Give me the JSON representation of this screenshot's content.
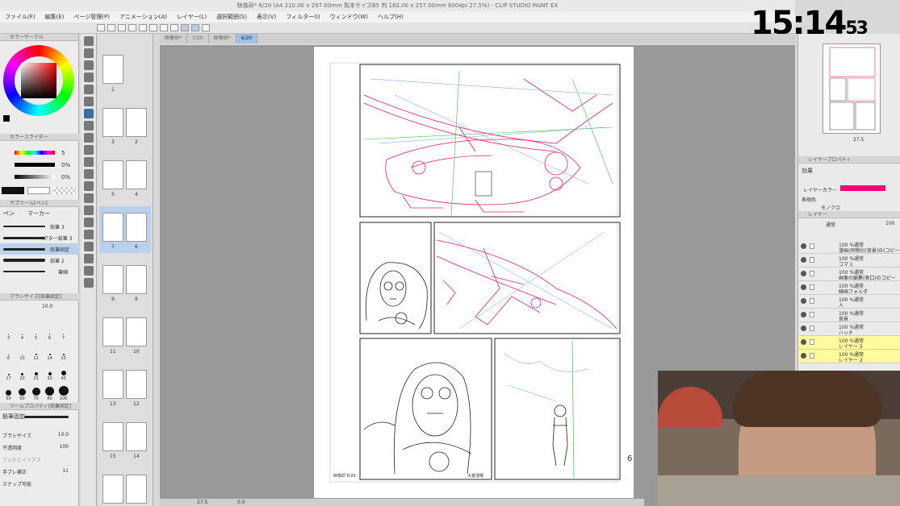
{
  "window": {
    "title": "映像研* 6/20 (A4 210.00 x 297.00mm 製本サイズB5 判 182.00 x 257.00mm 600dpi 27.5%) - CLIP STUDIO PAINT EX"
  },
  "menu": [
    "ファイル(F)",
    "編集(E)",
    "ページ管理(P)",
    "アニメーション(A)",
    "レイヤー(L)",
    "選択範囲(S)",
    "表示(V)",
    "フィルター(I)",
    "ウィンドウ(W)",
    "ヘルプ(H)"
  ],
  "clock": {
    "hm": "15:14",
    "sec": "53"
  },
  "tabs": [
    "映像研*",
    "7/20",
    "映像研*",
    "6/20"
  ],
  "left_panel": {
    "color_wheel_title": "カラーサークル",
    "color_slider_title": "カラースライダー",
    "slider_values": [
      "5",
      "0%",
      "0%"
    ],
    "subtool_title": "サブツール[ペン]",
    "subtool_tabs": [
      "ペン",
      "マーカー"
    ],
    "brushes": [
      "鉛筆 3",
      "ベクター鉛筆 3",
      "鉛筆固定",
      "鉛筆 2",
      "筆細"
    ],
    "brush_size_title": "ブラシサイズ[鉛筆固定]",
    "brush_size_value": "10.0",
    "brush_sizes": [
      "3",
      "4",
      "5",
      "6",
      "7",
      "8",
      "10",
      "12",
      "14",
      "15",
      "17",
      "20",
      "25",
      "30",
      "40",
      "50",
      "60",
      "70",
      "80",
      "100"
    ],
    "tool_property_title": "ツールプロパティ[鉛筆固定]",
    "tool_property_name": "鉛筆固定",
    "props": [
      {
        "label": "ブラシサイズ",
        "value": "10.0"
      },
      {
        "label": "不透明度",
        "value": "100"
      },
      {
        "label": "アンチエイリアス",
        "value": ""
      },
      {
        "label": "手ブレ補正",
        "value": "11"
      },
      {
        "label": "スナップ可能",
        "value": ""
      }
    ]
  },
  "navigator": {
    "pages": [
      "1",
      "3",
      "2",
      "5",
      "4",
      "7",
      "6",
      "9",
      "8",
      "11",
      "10",
      "13",
      "12",
      "15",
      "14"
    ]
  },
  "canvas": {
    "page_number": "6",
    "left_caption": "映像研 6/20",
    "right_caption": "大童澄瞳"
  },
  "status": {
    "zoom": "27.5",
    "angle": "0.0"
  },
  "right_panel": {
    "nav_zoom": "27.5",
    "layer_property_title": "レイヤープロパティ",
    "effect_label": "効果",
    "layer_color_label": "レイヤーカラー",
    "display_color_label": "表現色",
    "display_color_value": "モノクロ",
    "layer_panel_title": "レイヤー",
    "blend": "通常",
    "opacity": "100",
    "layers": [
      {
        "line1": "100 %通常",
        "line2": "漫画(同物0)(背景)の(コピー"
      },
      {
        "line1": "100 %通常",
        "line2": "コマ 1"
      },
      {
        "line1": "100 %通常",
        "line2": "画像の編集(表口)のコピー"
      },
      {
        "line1": "100 %通常",
        "line2": "線画フォルダ"
      },
      {
        "line1": "100 %通常",
        "line2": "人"
      },
      {
        "line1": "100 %通常",
        "line2": "背景"
      },
      {
        "line1": "100 %通常",
        "line2": "ハッチ"
      },
      {
        "line1": "100 %通常",
        "line2": "レイヤー 3"
      },
      {
        "line1": "100 %通常",
        "line2": "レイヤー 2"
      }
    ]
  },
  "colors": {
    "accent": "#3a6ea5",
    "layer_color": "#ff0077",
    "sketch_red": "#e8206a",
    "sketch_blue": "#6aa0e8",
    "sketch_green": "#3cc04a"
  }
}
